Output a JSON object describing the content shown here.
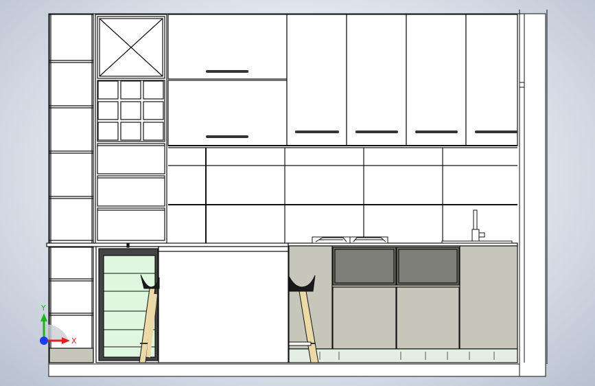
{
  "view": {
    "background_top": "#f6f8fb",
    "background_edge": "#b7c1cf"
  },
  "triad": {
    "x_label": "X",
    "y_label": "Y",
    "x_color": "#e02020",
    "y_color": "#1fb31f",
    "z_color": "#1a3cff"
  },
  "drawing": {
    "line_color": "#111111",
    "paper_color": "#ffffff",
    "base_cabinet_color": "#c7c6bb",
    "drawer_panel_color": "#7e7f78",
    "glass_color": "#dff6df",
    "plinth_color": "#e3efe3",
    "stool_leg_color": "#ecd9a8"
  }
}
